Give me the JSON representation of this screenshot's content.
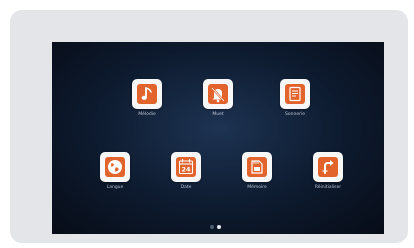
{
  "apps": [
    {
      "label": "Mélodie",
      "icon": "music-note-icon"
    },
    {
      "label": "Muet",
      "icon": "bell-muted-icon"
    },
    {
      "label": "Sonnerie",
      "icon": "ring-document-icon"
    },
    {
      "label": "Langue",
      "icon": "globe-icon"
    },
    {
      "label": "Date",
      "icon": "calendar-icon"
    },
    {
      "label": "Mémoire",
      "icon": "memory-card-icon"
    },
    {
      "label": "Réinitialiser",
      "icon": "reset-icon"
    }
  ],
  "calendar_day": "24",
  "pagination": {
    "pages": 2,
    "active": 2
  },
  "colors": {
    "accent": "#e2632b",
    "tile": "#f7f7f7",
    "label": "#b9c3d3"
  }
}
